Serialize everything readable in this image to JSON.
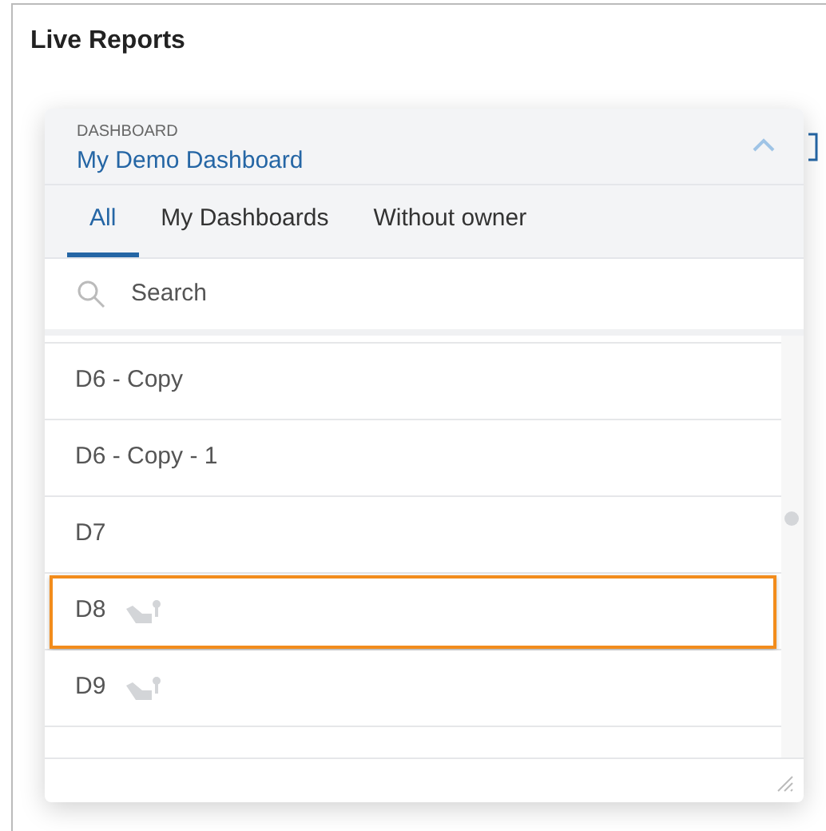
{
  "page": {
    "title": "Live Reports"
  },
  "dropdown": {
    "label": "DASHBOARD",
    "value": "My Demo Dashboard",
    "expanded": true,
    "tabs": [
      {
        "label": "All",
        "selected": true
      },
      {
        "label": "My Dashboards",
        "selected": false
      },
      {
        "label": "Without owner",
        "selected": false
      }
    ],
    "search": {
      "placeholder": "Search"
    },
    "items": [
      {
        "label": "D6 - Copy",
        "icon": false,
        "focused": false
      },
      {
        "label": "D6 - Copy - 1",
        "icon": false,
        "focused": false
      },
      {
        "label": "D7",
        "icon": false,
        "focused": false
      },
      {
        "label": "D8",
        "icon": true,
        "focused": true
      },
      {
        "label": "D9",
        "icon": true,
        "focused": false
      }
    ]
  }
}
